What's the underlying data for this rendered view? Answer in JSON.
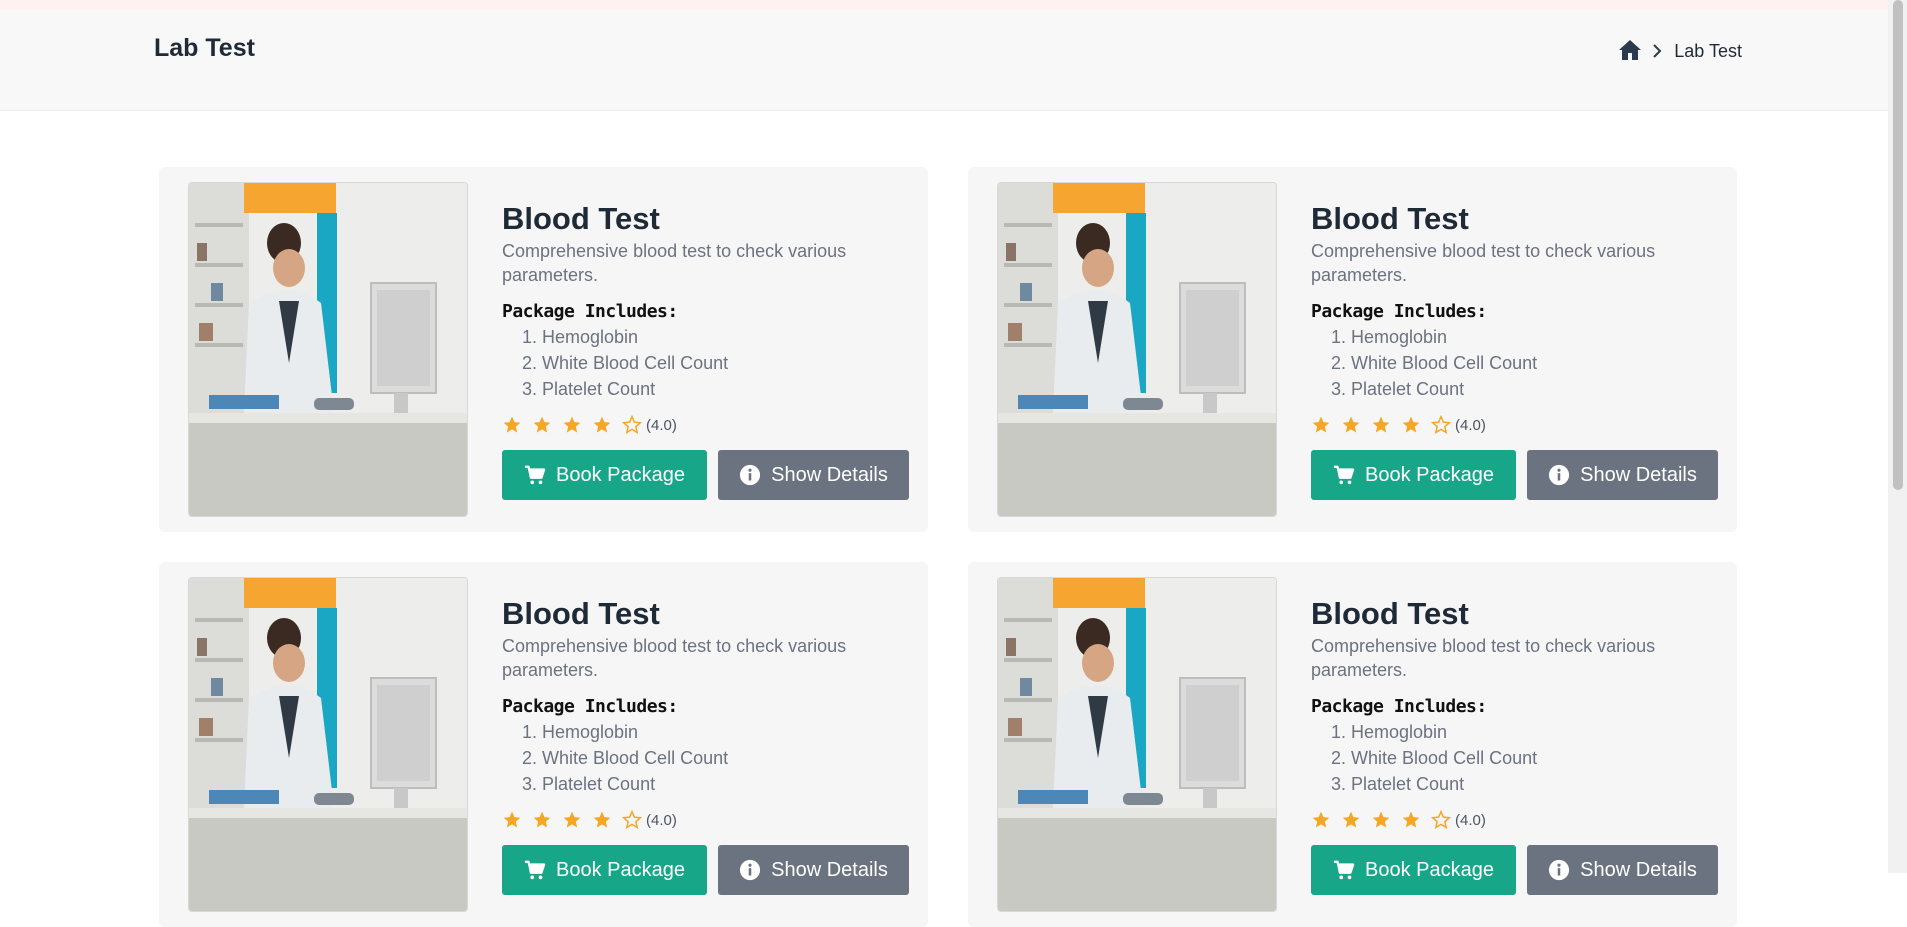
{
  "header": {
    "title": "Lab Test",
    "breadcrumb": {
      "home_icon": "home-icon",
      "separator_icon": "chevron-right-icon",
      "current": "Lab Test"
    }
  },
  "colors": {
    "primary": "#18a689",
    "secondary": "#6b7280",
    "star": "#f5a623",
    "card_bg": "#f6f6f6"
  },
  "cards": [
    {
      "image_icon": "lab-photo",
      "title": "Blood Test",
      "description": "Comprehensive blood test to check various parameters.",
      "includes_heading": "Package Includes:",
      "items": [
        "1. Hemoglobin",
        "2. White Blood Cell Count",
        "3. Platelet Count"
      ],
      "rating": 4,
      "rating_text": "(4.0)",
      "book_label": "Book Package",
      "details_label": "Show Details"
    },
    {
      "image_icon": "lab-photo",
      "title": "Blood Test",
      "description": "Comprehensive blood test to check various parameters.",
      "includes_heading": "Package Includes:",
      "items": [
        "1. Hemoglobin",
        "2. White Blood Cell Count",
        "3. Platelet Count"
      ],
      "rating": 4,
      "rating_text": "(4.0)",
      "book_label": "Book Package",
      "details_label": "Show Details"
    },
    {
      "image_icon": "lab-photo",
      "title": "Blood Test",
      "description": "Comprehensive blood test to check various parameters.",
      "includes_heading": "Package Includes:",
      "items": [
        "1. Hemoglobin",
        "2. White Blood Cell Count",
        "3. Platelet Count"
      ],
      "rating": 4,
      "rating_text": "(4.0)",
      "book_label": "Book Package",
      "details_label": "Show Details"
    },
    {
      "image_icon": "lab-photo",
      "title": "Blood Test",
      "description": "Comprehensive blood test to check various parameters.",
      "includes_heading": "Package Includes:",
      "items": [
        "1. Hemoglobin",
        "2. White Blood Cell Count",
        "3. Platelet Count"
      ],
      "rating": 4,
      "rating_text": "(4.0)",
      "book_label": "Book Package",
      "details_label": "Show Details"
    }
  ]
}
